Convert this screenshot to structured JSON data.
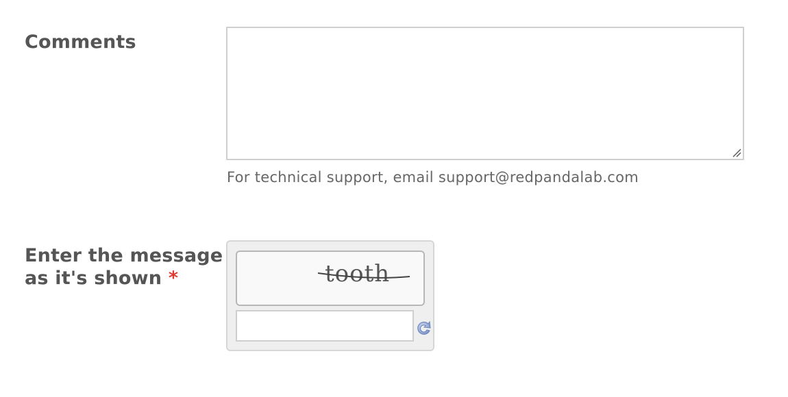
{
  "comments": {
    "label": "Comments",
    "value": "",
    "help_text": "For technical support, email support@redpandalab.com"
  },
  "captcha": {
    "label": "Enter the message as it's shown",
    "required_mark": "*",
    "image_text": "tooth",
    "input_value": "",
    "refresh_icon": "refresh-icon"
  },
  "colors": {
    "label": "#555555",
    "required": "#e03a2f",
    "help_text": "#666666",
    "border": "#cfcfcf",
    "captcha_bg": "#efefef"
  }
}
